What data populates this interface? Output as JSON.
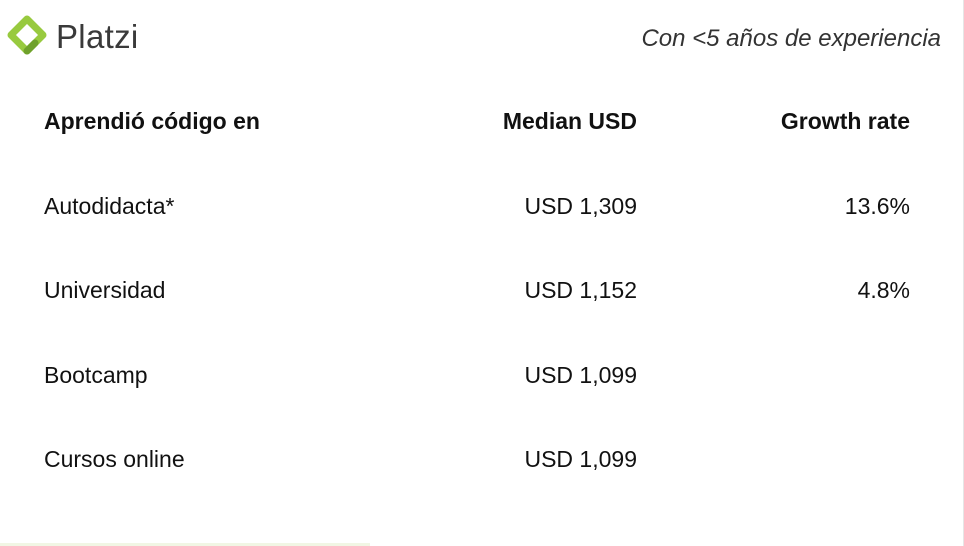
{
  "brand": {
    "name": "Platzi",
    "logo_icon": "platzi-logo-icon",
    "logo_colors": [
      "#98ca3f",
      "#6fa12c"
    ]
  },
  "subtitle": "Con <5 años de experiencia",
  "table": {
    "headers": [
      "Aprendió código en",
      "Median USD",
      "Growth rate"
    ],
    "rows": [
      [
        "Autodidacta*",
        "USD 1,309",
        "13.6%"
      ],
      [
        "Universidad",
        "USD 1,152",
        "4.8%"
      ],
      [
        "Bootcamp",
        "USD 1,099",
        ""
      ],
      [
        "Cursos online",
        "USD 1,099",
        ""
      ]
    ]
  }
}
